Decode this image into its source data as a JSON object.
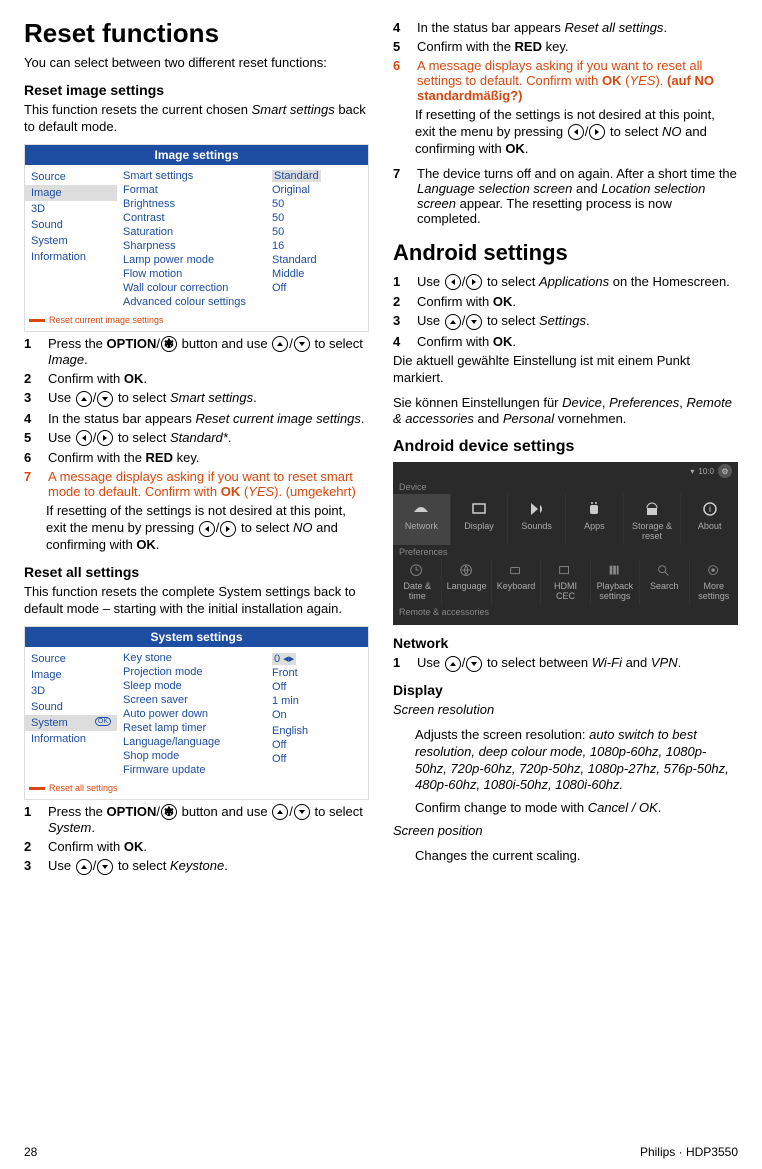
{
  "heading_reset_functions": "Reset functions",
  "intro_reset": "You can select between two different reset functions:",
  "h_reset_image": "Reset image settings",
  "p_reset_image_1a": "This function resets the current chosen ",
  "p_reset_image_1b": "Smart settings",
  "p_reset_image_1c": " back to default mode.",
  "panel1": {
    "title": "Image settings",
    "nav": [
      "Source",
      "Image",
      "3D",
      "Sound",
      "System",
      "Information"
    ],
    "nav_sel": 1,
    "items": [
      "Smart settings",
      "Format",
      "Brightness",
      "Contrast",
      "Saturation",
      "Sharpness",
      "Lamp power mode",
      "Flow motion",
      "Wall colour correction",
      "Advanced colour settings"
    ],
    "vals": [
      "Standard",
      "Original",
      "50",
      "50",
      "50",
      "16",
      "Standard",
      "Middle",
      "Off",
      ""
    ],
    "val_sel": 0,
    "foot": "Reset current image settings"
  },
  "s1_1a": "Press the ",
  "s1_1b": "OPTION",
  "s1_1c": "/",
  "s1_1d": " button and use ",
  "s1_1e": "/",
  "s1_1f": " to select ",
  "s1_1g": "Image",
  "s1_1h": ".",
  "s1_2a": "Confirm with ",
  "s1_2b": "OK",
  "s1_2c": ".",
  "s1_3a": "Use ",
  "s1_3b": "/",
  "s1_3c": " to select ",
  "s1_3d": "Smart settings",
  "s1_3e": ".",
  "s1_4a": "In the status bar appears ",
  "s1_4b": "Reset current image settings",
  "s1_4c": ".",
  "s1_5a": "Use ",
  "s1_5b": "/",
  "s1_5c": " to select ",
  "s1_5d": "Standard*",
  "s1_5e": ".",
  "s1_6a": "Confirm with the ",
  "s1_6b": "RED",
  "s1_6c": " key.",
  "s1_7a": "A message displays asking if you want to reset smart mode to default. Confirm with ",
  "s1_7b": "OK",
  "s1_7c": " (",
  "s1_7d": "YES",
  "s1_7e": "). (umgekehrt)",
  "s1_note_a": "If resetting of the settings is not desired at this point, exit the menu by pressing ",
  "s1_note_b": "/",
  "s1_note_c": " to select ",
  "s1_note_d": "NO",
  "s1_note_e": " and confirming with ",
  "s1_note_f": "OK",
  "s1_note_g": ".",
  "h_reset_all": "Reset all settings",
  "p_reset_all": "This function resets the complete System settings back to default mode – starting with the initial installation again.",
  "panel2": {
    "title": "System settings",
    "nav": [
      "Source",
      "Image",
      "3D",
      "Sound",
      "System",
      "Information"
    ],
    "nav_sel": 4,
    "items": [
      "Key stone",
      "Projection mode",
      "Sleep mode",
      "Screen saver",
      "Auto power down",
      "Reset lamp timer",
      "Language/language",
      "Shop mode",
      "Firmware update"
    ],
    "vals": [
      "0  ◂▸",
      "Front",
      "Off",
      "1 min",
      "On",
      "",
      "English",
      "Off",
      "Off"
    ],
    "val_sel": 0,
    "foot": "Reset all settings"
  },
  "s2_1a": "Press the ",
  "s2_1b": "OPTION",
  "s2_1c": "/",
  "s2_1d": " button and use ",
  "s2_1e": "/",
  "s2_1f": " to select ",
  "s2_1g": "System",
  "s2_1h": ".",
  "s2_2a": "Confirm with ",
  "s2_2b": "OK",
  "s2_2c": ".",
  "s2_3a": "Use ",
  "s2_3b": "/",
  "s2_3c": " to select ",
  "s2_3d": "Keystone",
  "s2_3e": ".",
  "r_4a": "In the status bar appears ",
  "r_4b": "Reset all settings",
  "r_4c": ".",
  "r_5a": "Confirm with the ",
  "r_5b": "RED",
  "r_5c": " key.",
  "r_6a": "A message displays asking if you want to reset all settings to default. Confirm with ",
  "r_6b": "OK",
  "r_6c": " (",
  "r_6d": "YES",
  "r_6e": "). ",
  "r_6f": "(auf NO standardmäßig?)",
  "r_note_a": "If resetting of the settings is not desired at this point, exit the menu by pressing ",
  "r_note_b": "/",
  "r_note_c": " to select ",
  "r_note_d": "NO",
  "r_note_e": " and confirming with ",
  "r_note_f": "OK",
  "r_note_g": ".",
  "r_7a": "The device turns off and on again. After a short time the ",
  "r_7b": "Language selection screen",
  "r_7c": " and ",
  "r_7d": "Location selection screen",
  "r_7e": " appear. The resetting process is now completed.",
  "h_android": "Android settings",
  "a_1a": "Use ",
  "a_1b": "/",
  "a_1c": " to select ",
  "a_1d": "Applications",
  "a_1e": " on the Homescreen.",
  "a_2a": "Confirm with ",
  "a_2b": "OK",
  "a_2c": ".",
  "a_3a": "Use ",
  "a_3b": "/",
  "a_3c": " to select ",
  "a_3d": "Settings",
  "a_3e": ".",
  "a_4a": "Confirm with ",
  "a_4b": "OK",
  "a_4c": ".",
  "p_de1": "Die aktuell gewählte Einstellung ist mit einem Punkt markiert.",
  "p_de2a": "Sie können Einstellungen für ",
  "p_de2b": "Device",
  "p_de2c": ", ",
  "p_de2d": "Preferences",
  "p_de2e": ", ",
  "p_de2f": "Remote & accessories",
  "p_de2g": " and ",
  "p_de2h": "Personal",
  "p_de2i": " vornehmen.",
  "h_android_dev": "Android device settings",
  "android": {
    "time": "10:0",
    "sec_device": "Device",
    "row1": [
      "Network",
      "Display",
      "Sounds",
      "Apps",
      "Storage & reset",
      "About"
    ],
    "sec_pref": "Preferences",
    "row2": [
      "Date & time",
      "Language",
      "Keyboard",
      "HDMI CEC",
      "Playback settings",
      "Search",
      "More settings"
    ],
    "sec_remote": "Remote & accessories"
  },
  "h_network": "Network",
  "n_1a": "Use ",
  "n_1b": "/",
  "n_1c": " to select between ",
  "n_1d": "Wi-Fi",
  "n_1e": " and ",
  "n_1f": "VPN",
  "n_1g": ".",
  "h_display": "Display",
  "disp_res_h": "Screen resolution",
  "disp_res_1a": "Adjusts the screen resolution: ",
  "disp_res_1b": "auto switch to best resolution, deep colour mode, 1080p-60hz, 1080p-50hz, 720p-60hz, 720p-50hz, 1080p-27hz, 576p-50hz, 480p-60hz, 1080i-50hz, 1080i-60hz.",
  "disp_res_2a": "Confirm change to mode with ",
  "disp_res_2b": "Cancel / OK",
  "disp_res_2c": ".",
  "disp_pos_h": "Screen position",
  "disp_pos_1": "Changes the current scaling.",
  "page_no": "28",
  "model": "Philips · HDP3550"
}
